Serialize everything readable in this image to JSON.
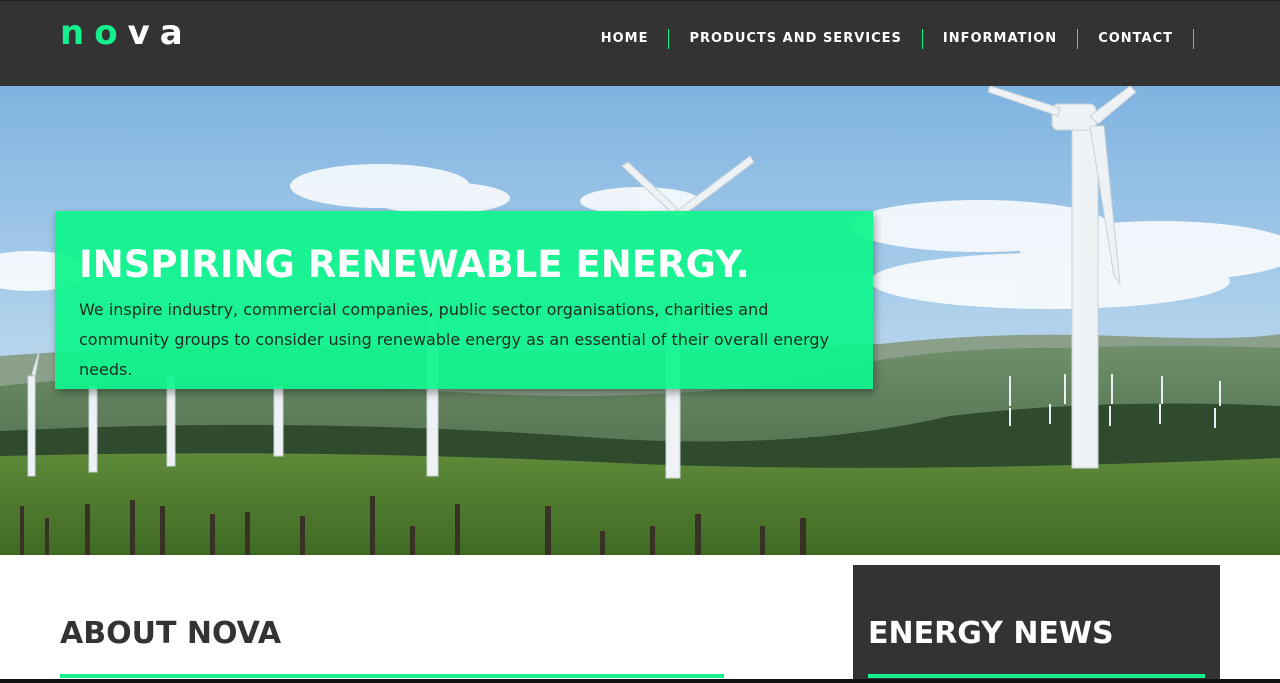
{
  "brand": {
    "logo_part1": "no",
    "logo_part2": "va",
    "accent_color": "#14f08e",
    "header_bg": "#333333"
  },
  "nav": {
    "items": [
      {
        "label": "HOME"
      },
      {
        "label": "PRODUCTS AND SERVICES"
      },
      {
        "label": "INFORMATION"
      },
      {
        "label": "CONTACT"
      }
    ]
  },
  "hero": {
    "title": "INSPIRING RENEWABLE ENERGY.",
    "text": "We inspire industry, commercial companies, public sector organisations, charities and community groups to consider using renewable energy as an essential of their overall energy needs.",
    "image_subject": "wind-turbines-landscape"
  },
  "about": {
    "title": "ABOUT NOVA"
  },
  "news": {
    "title": "ENERGY NEWS"
  }
}
